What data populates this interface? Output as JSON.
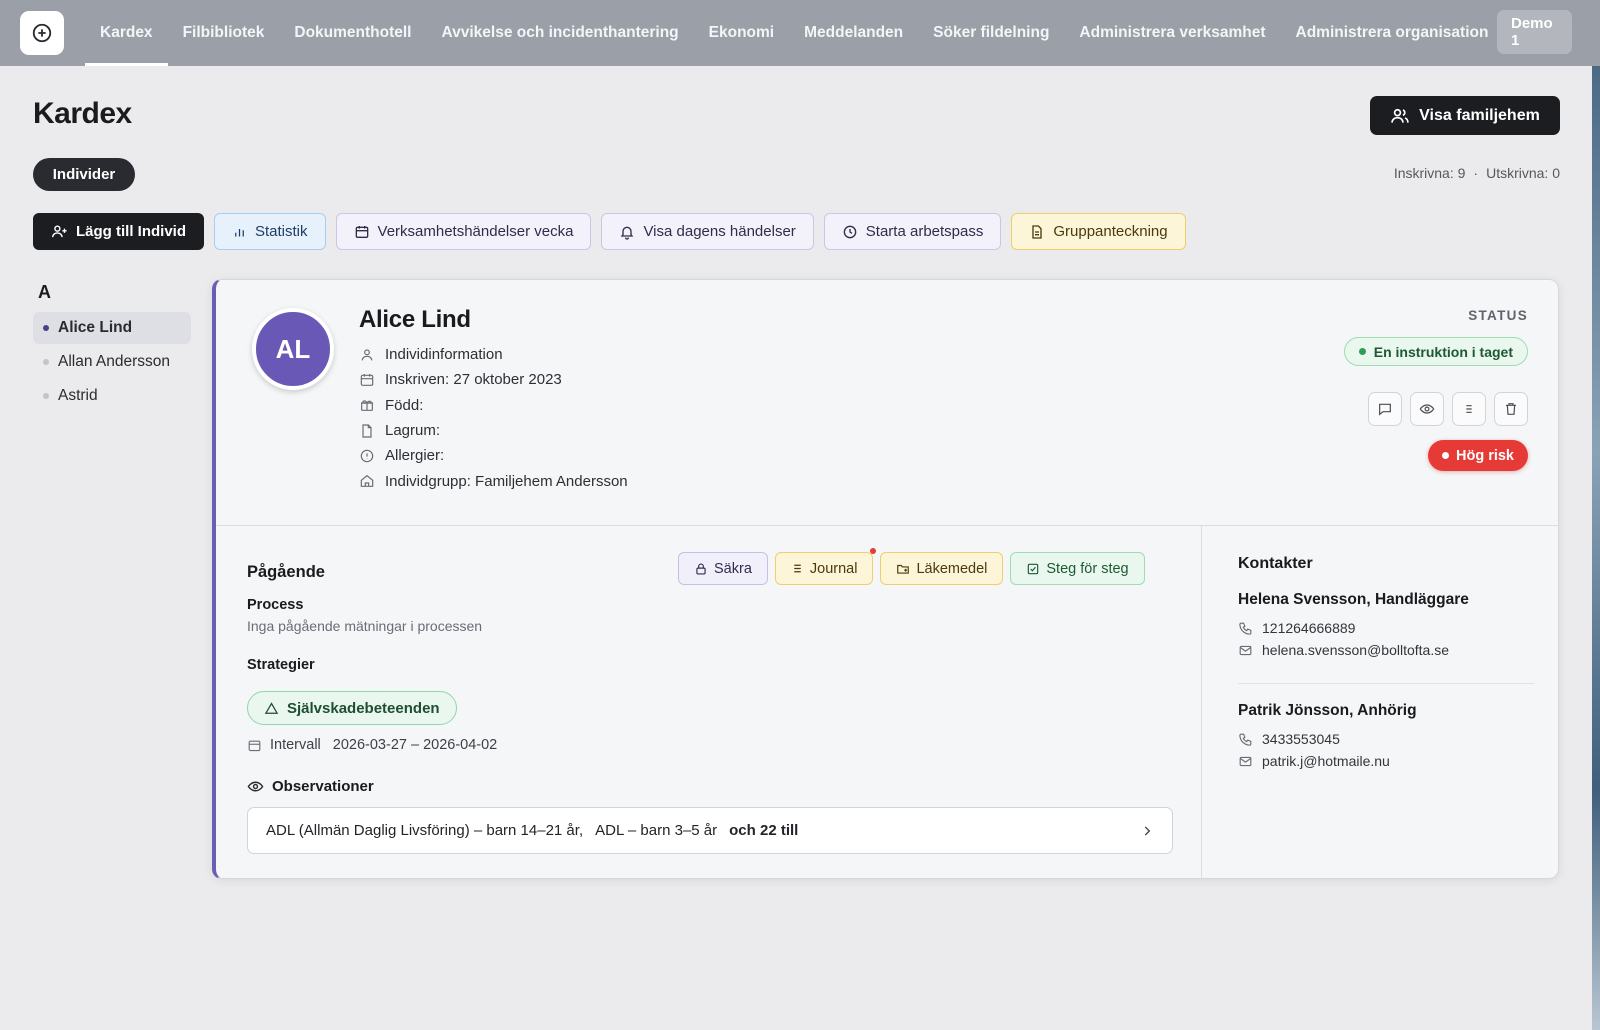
{
  "nav": {
    "items": [
      {
        "label": "Kardex",
        "active": true
      },
      {
        "label": "Filbibliotek",
        "active": false
      },
      {
        "label": "Dokumenthotell",
        "active": false
      },
      {
        "label": "Avvikelse och incidenthantering",
        "active": false
      },
      {
        "label": "Ekonomi",
        "active": false
      },
      {
        "label": "Meddelanden",
        "active": false
      },
      {
        "label": "Söker fildelning",
        "active": false
      },
      {
        "label": "Administrera verksamhet",
        "active": false
      },
      {
        "label": "Administrera organisation",
        "active": false
      }
    ],
    "user_line1": "Demo",
    "user_line2": "1",
    "logo_icon": "plus-circle-icon"
  },
  "header": {
    "title": "Kardex",
    "primary_button": "Visa familjehem",
    "filter_pill": "Individer",
    "counts": {
      "inskrivna": "Inskrivna: 9",
      "separator": "·",
      "utskrivna": "Utskrivna: 0"
    }
  },
  "actions": [
    {
      "label": "Lägg till Individ",
      "icon": "add-user-icon",
      "style": "dark"
    },
    {
      "label": "Statistik",
      "icon": "bar-chart-icon",
      "style": "blue"
    },
    {
      "label": "Verksamhetshändelser vecka",
      "icon": "calendar-icon",
      "style": "purple"
    },
    {
      "label": "Visa dagens händelser",
      "icon": "bell-icon",
      "style": "purple"
    },
    {
      "label": "Starta arbetspass",
      "icon": "clock-icon",
      "style": "purple"
    },
    {
      "label": "Gruppanteckning",
      "icon": "document-icon",
      "style": "yellow"
    }
  ],
  "sidebar": {
    "letter": "A",
    "individuals": [
      {
        "name": "Alice Lind",
        "active": true
      },
      {
        "name": "Allan Andersson",
        "active": false
      },
      {
        "name": "Astrid",
        "active": false
      }
    ]
  },
  "card": {
    "initials": "AL",
    "name": "Alice Lind",
    "info": [
      {
        "icon": "user-icon",
        "text": "Individinformation"
      },
      {
        "icon": "calendar-icon",
        "text": "Inskriven: 27 oktober 2023"
      },
      {
        "icon": "gift-icon",
        "text": "Född:"
      },
      {
        "icon": "file-icon",
        "text": "Lagrum:"
      },
      {
        "icon": "alert-circle-icon",
        "text": "Allergier:"
      },
      {
        "icon": "home-icon",
        "text": "Individgrupp: Familjehem Andersson"
      }
    ],
    "status_label": "STATUS",
    "status": "En instruktion i taget",
    "risk": "Hög risk",
    "ongoing": {
      "title": "Pågående",
      "chips": [
        {
          "label": "Säkra",
          "icon": "lock-icon",
          "style": "purple"
        },
        {
          "label": "Journal",
          "icon": "list-icon",
          "style": "yellow"
        },
        {
          "label": "Läkemedel",
          "icon": "folder-icon",
          "style": "yellow"
        },
        {
          "label": "Steg för steg",
          "icon": "checkbox-icon",
          "style": "green"
        }
      ],
      "process_title": "Process",
      "process_text": "Inga pågående mätningar i processen",
      "strategies_title": "Strategier",
      "strategy": "Självskadebeteenden",
      "interval_label": "Intervall",
      "interval_value": "2026-03-27 – 2026-04-02",
      "observations_title": "Observationer",
      "observation_1": "ADL (Allmän Daglig Livsföring) – barn 14–21 år,",
      "observation_2": "ADL – barn 3–5 år",
      "observation_more": "och 22 till"
    },
    "contacts": {
      "title": "Kontakter",
      "list": [
        {
          "name": "Helena Svensson, Handläggare",
          "phone": "121264666889",
          "email": "helena.svensson@bolltofta.se"
        },
        {
          "name": "Patrik Jönsson, Anhörig",
          "phone": "3433553045",
          "email": "patrik.j@hotmaile.nu"
        }
      ]
    }
  }
}
